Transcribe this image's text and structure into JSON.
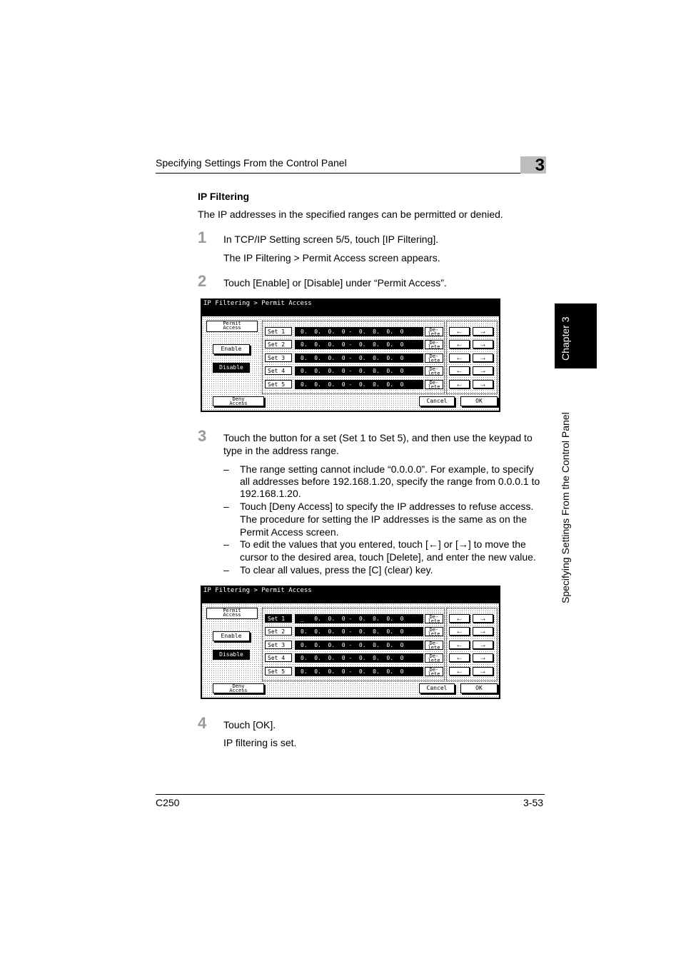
{
  "header": {
    "title": "Specifying Settings From the Control Panel",
    "chapter_number": "3"
  },
  "side_tab": {
    "chapter": "Chapter 3",
    "section": "Specifying Settings From the Control Panel"
  },
  "section_title": "IP Filtering",
  "intro": "The IP addresses in the specified ranges can be permitted or denied.",
  "steps": [
    {
      "num": "1",
      "text": "In TCP/IP Setting screen 5/5, touch [IP Filtering].",
      "result": "The IP Filtering > Permit Access screen appears."
    },
    {
      "num": "2",
      "text": "Touch [Enable] or [Disable] under “Permit Access”."
    },
    {
      "num": "3",
      "text_line1": "Touch the button for a set (Set 1 to Set 5), and then use the keypad to",
      "text_line2": "type in the address range."
    },
    {
      "num": "4",
      "text": "Touch [OK].",
      "result": "IP filtering is set."
    }
  ],
  "bullets": [
    {
      "dash": "–",
      "lines": [
        "The range setting cannot include “0.0.0.0”. For example, to specify",
        "all addresses before 192.168.1.20, specify the range from 0.0.0.1 to",
        "192.168.1.20."
      ]
    },
    {
      "dash": "–",
      "lines": [
        "Touch [Deny Access] to specify the IP addresses to refuse access.",
        "The procedure for setting the IP addresses is the same as on the",
        "Permit Access screen."
      ]
    },
    {
      "dash": "–",
      "lines": [
        "To edit the values that you entered, touch [←] or [→] to move the",
        "cursor to the desired area, touch [Delete], and enter the new value."
      ]
    },
    {
      "dash": "–",
      "lines": [
        "To clear all values, press the [C] (clear) key."
      ]
    }
  ],
  "screen": {
    "title": "IP Filtering > Permit Access",
    "permit_access_l1": "Permit",
    "permit_access_l2": "Access",
    "enable": "Enable",
    "disable": "Disable",
    "deny_l1": "Deny",
    "deny_l2": "Access",
    "cancel": "Cancel",
    "ok": "OK",
    "delete_l1": "De-",
    "delete_l2": "lete",
    "left_arrow": "←",
    "right_arrow": "→",
    "sets": [
      "Set 1",
      "Set 2",
      "Set 3",
      "Set 4",
      "Set 5"
    ],
    "address": "0.  0.  0.  0 -  0.  0.  0.  0",
    "address_cursor": "_   0.  0.  0 -  0.  0.  0.  0"
  },
  "footer": {
    "model": "C250",
    "page": "3-53"
  }
}
